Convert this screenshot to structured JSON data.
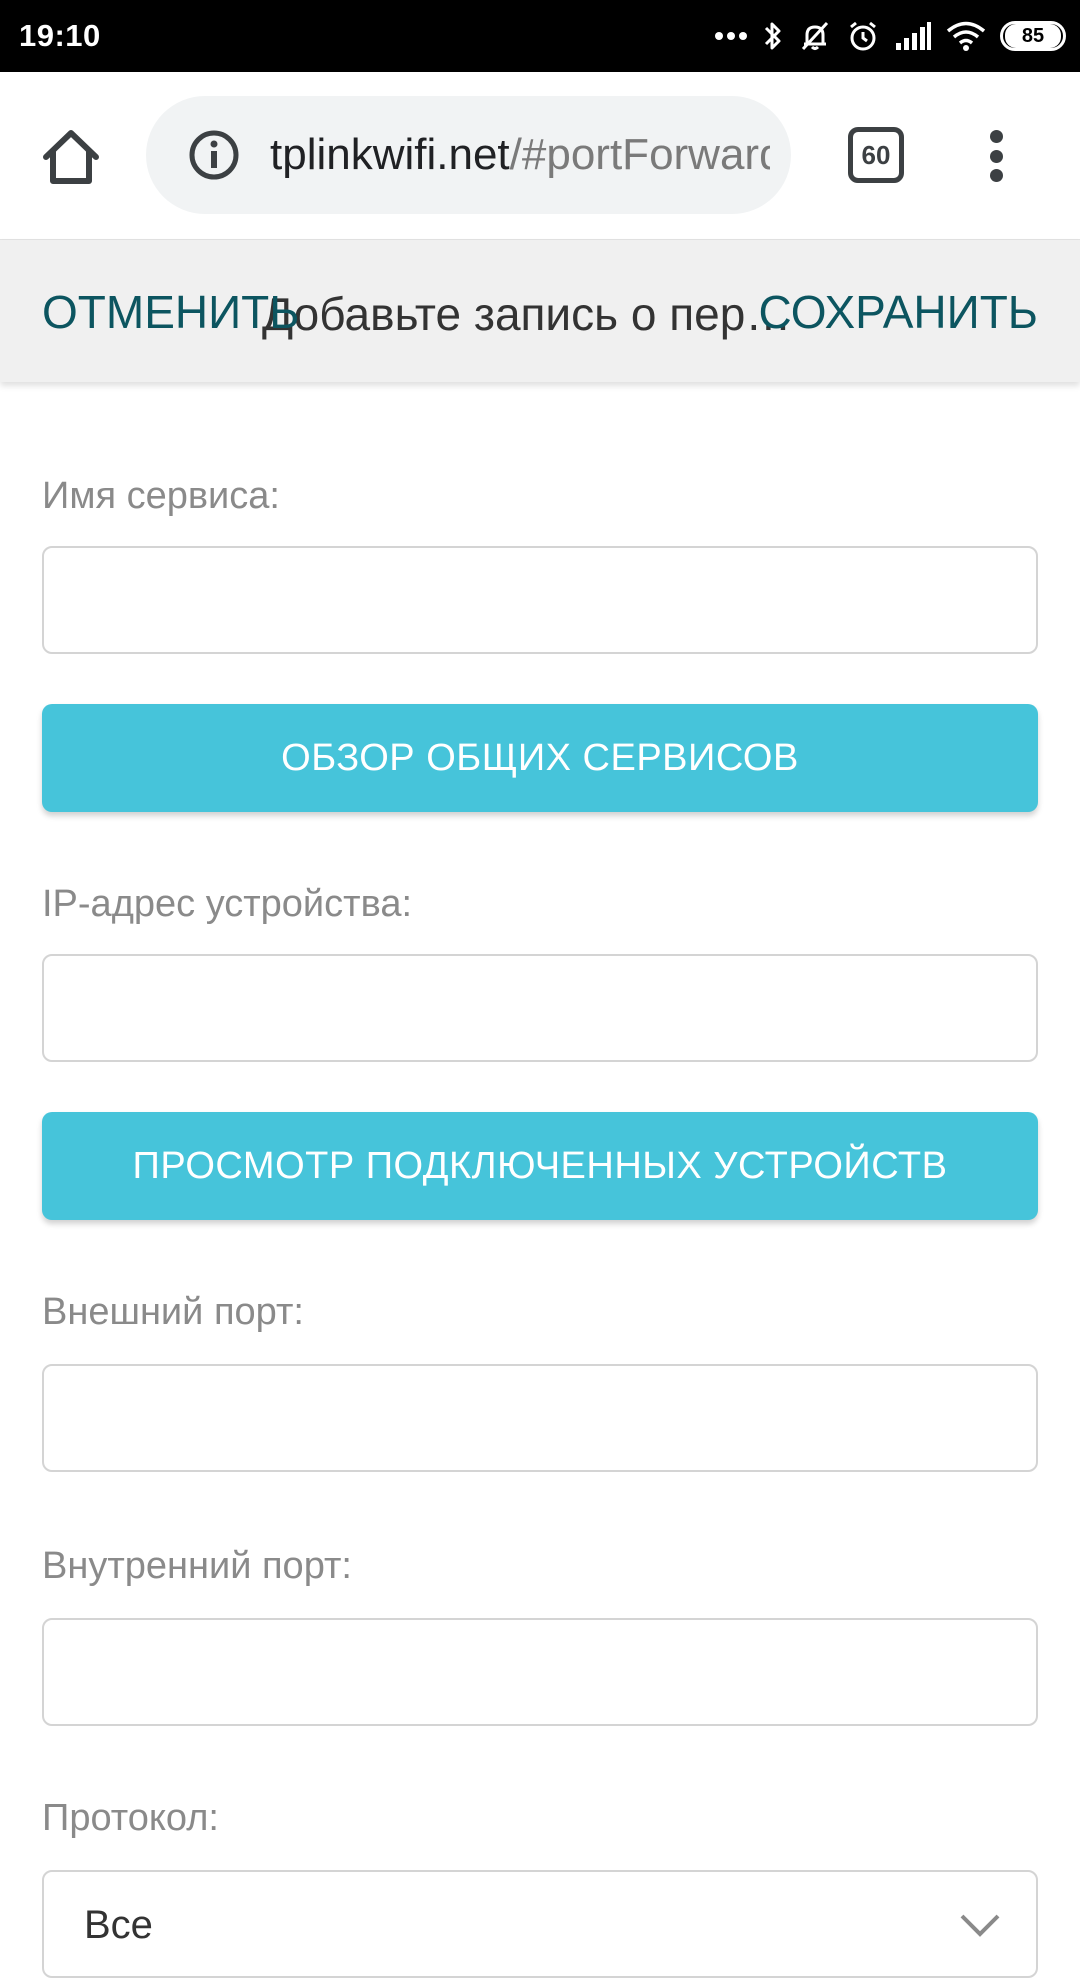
{
  "status_bar": {
    "time": "19:10",
    "battery": "85",
    "icons": [
      "more-dots-icon",
      "bluetooth-icon",
      "muted-bell-icon",
      "alarm-icon",
      "signal-icon",
      "wifi-icon",
      "battery-icon"
    ]
  },
  "browser": {
    "url_host": "tplinkwifi.net",
    "url_path": "/#portForwarding",
    "tab_count": "60",
    "icons": [
      "home-icon",
      "info-icon",
      "tab-switcher-icon",
      "overflow-menu-icon"
    ]
  },
  "action_bar": {
    "cancel_label": "ОТМЕНИТЬ",
    "title": "Добавьте запись о переадресации портов",
    "save_label": "СОХРАНИТЬ"
  },
  "form": {
    "service_name": {
      "label": "Имя сервиса:",
      "value": ""
    },
    "browse_services_button": "ОБЗОР ОБЩИХ СЕРВИСОВ",
    "device_ip": {
      "label": "IP-адрес устройства:",
      "value": ""
    },
    "view_devices_button": "ПРОСМОТР ПОДКЛЮЧЕННЫХ УСТРОЙСТВ",
    "external_port": {
      "label": "Внешний порт:",
      "value": ""
    },
    "internal_port": {
      "label": "Внутренний порт:",
      "value": ""
    },
    "protocol": {
      "label": "Протокол:",
      "selected": "Все"
    }
  },
  "colors": {
    "accent_button": "#46c4da",
    "action_text": "#0c5560",
    "label_text": "#8a8a8a",
    "action_bar_bg": "#f0f0f0"
  }
}
